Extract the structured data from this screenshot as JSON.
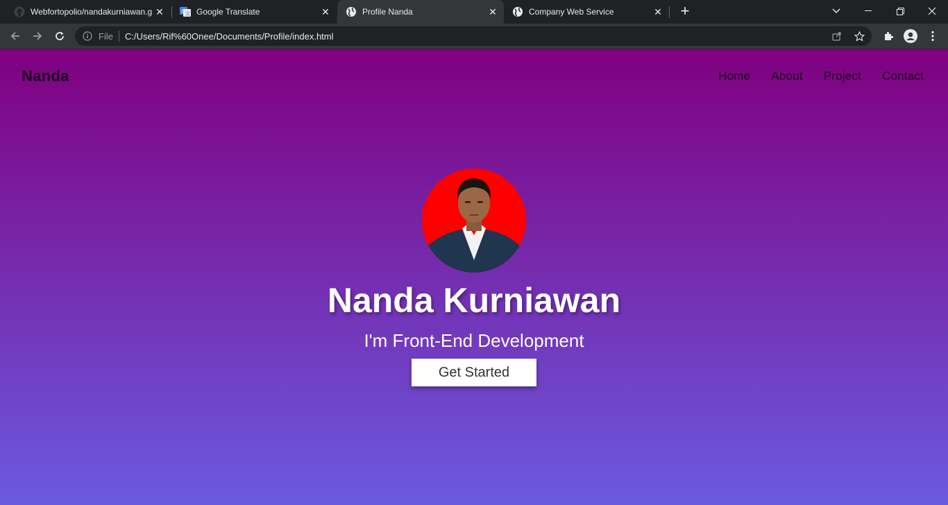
{
  "browser": {
    "tabs": [
      {
        "title": "Webfortopolio/nandakurniawan.g",
        "icon": "github-icon"
      },
      {
        "title": "Google Translate",
        "icon": "google-translate-icon"
      },
      {
        "title": "Profile Nanda",
        "icon": "globe-icon",
        "active": true
      },
      {
        "title": "Company Web Service",
        "icon": "globe-icon"
      }
    ],
    "address": {
      "scheme_label": "File",
      "url": "C:/Users/Rif%60Onee/Documents/Profile/index.html"
    }
  },
  "site": {
    "brand": "Nanda",
    "nav": [
      "Home",
      "About",
      "Project",
      "Contact"
    ],
    "hero": {
      "name": "Nanda Kurniawan",
      "subtitle": "I'm Front-End Development",
      "cta_label": "Get Started"
    }
  },
  "colors": {
    "gradient_top": "#800080",
    "gradient_bottom": "#6a5ae0",
    "avatar_background": "#ff0000",
    "chrome_dark": "#202124",
    "chrome_toolbar": "#35363a"
  }
}
